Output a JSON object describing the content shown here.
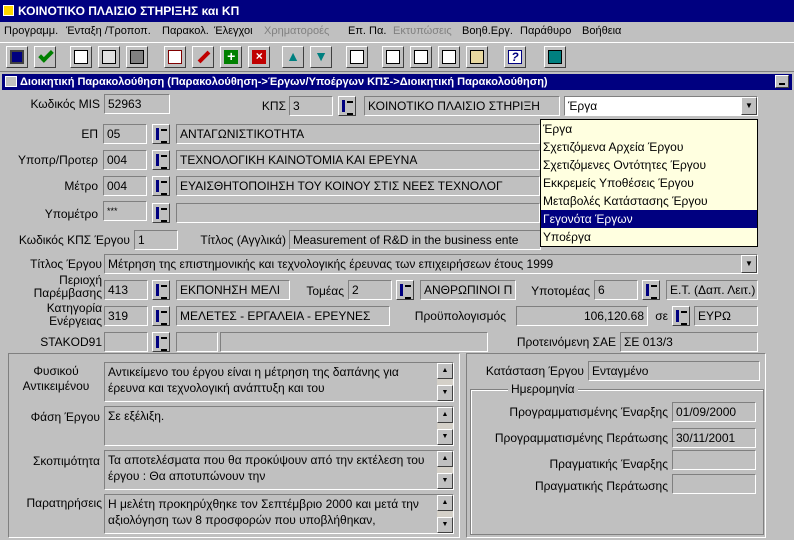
{
  "window": {
    "title": "ΚΟΙΝΟΤΙΚΟ ΠΛΑΙΣΙΟ ΣΤΗΡΙΞΗΣ και ΚΠ"
  },
  "menu": [
    {
      "label": "Προγραμμ.",
      "enabled": true
    },
    {
      "label": "Ένταξη /Τροποπ.",
      "enabled": true
    },
    {
      "label": "Παρακολ.",
      "enabled": true
    },
    {
      "label": "Έλεγχοι",
      "enabled": true
    },
    {
      "label": "Χρηματοροές",
      "enabled": false
    },
    {
      "label": "Επ. Πα.",
      "enabled": true
    },
    {
      "label": "Εκτυπώσεις",
      "enabled": false
    },
    {
      "label": "Βοηθ.Εργ.",
      "enabled": true
    },
    {
      "label": "Παράθυρο",
      "enabled": true
    },
    {
      "label": "Βοήθεια",
      "enabled": true
    }
  ],
  "toolbar_icons": [
    "save-icon",
    "check-icon",
    "print-icon",
    "copy-icon",
    "calculator-icon",
    "chart-icon",
    "edit-icon",
    "add-icon",
    "delete-icon",
    "arrow-up-icon",
    "arrow-down-icon",
    "list-icon",
    "table-icon",
    "document-icon",
    "report-icon",
    "clipboard-icon",
    "help-icon",
    "exit-icon"
  ],
  "subwindow": {
    "title": "Διοικητική Παρακολούθηση (Παρακολούθηση->Έργων/Υποέργων ΚΠΣ->Διοικητική Παρακολούθηση)"
  },
  "form": {
    "mis_label": "Κωδικός MIS",
    "mis_value": "52963",
    "kps_label": "ΚΠΣ",
    "kps_code": "3",
    "kps_name": "ΚΟΙΝΟΤΙΚΟ ΠΛΑΙΣΙΟ ΣΤΗΡΙΞΗ",
    "combo_value": "Έργα",
    "ep_label": "ΕΠ",
    "ep_code": "05",
    "ep_name": "ΑΝΤΑΓΩΝΙΣΤΙΚΟΤΗΤΑ",
    "ypopr_label": "Υποπρ/Προτερ",
    "ypopr_code": "004",
    "ypopr_name": "ΤΕΧΝΟΛΟΓΙΚΗ ΚΑΙΝΟΤΟΜΙΑ ΚΑΙ ΕΡΕΥΝΑ",
    "metro_label": "Μέτρο",
    "metro_code": "004",
    "metro_name": "ΕΥΑΙΣΘΗΤΟΠΟΙΗΣΗ ΤΟΥ ΚΟΙΝΟΥ ΣΤΙΣ ΝΕΕΣ ΤΕΧΝΟΛΟΓ",
    "ypometro_label": "Υπομέτρο",
    "ypometro_code": "***",
    "ypometro_name": "",
    "kps_ergou_label": "Κωδικός ΚΠΣ Έργου",
    "kps_ergou_value": "1",
    "title_en_label": "Τίτλος (Αγγλικά)",
    "title_en_value": "Measurement of R&D in the business ente",
    "title_label": "Τίτλος Έργου",
    "title_value": "Μέτρηση της επιστημονικής και τεχνολογικής έρευνας των επιχειρήσεων έτους 1999",
    "perioxi_label": "Περιοχή Παρέμβασης",
    "perioxi_code": "413",
    "perioxi_name": "ΕΚΠΟΝΗΣΗ ΜΕΛΙ",
    "tomeas_label": "Τομέας",
    "tomeas_code": "2",
    "tomeas_name": "ΑΝΘΡΩΠΙΝΟΙ Π",
    "ypotomeas_label": "Υποτομέας",
    "ypotomeas_code": "6",
    "ypotomeas_name": "Ε.Τ. (Δαπ. Λειτ.)",
    "katigoria_label": "Κατηγορία Ενέργειας",
    "katigoria_code": "319",
    "katigoria_name": "ΜΕΛΕΤΕΣ - ΕΡΓΑΛΕΙΑ - ΕΡΕΥΝΕΣ",
    "budget_label": "Προϋπολογισμός",
    "budget_value": "106,120.68",
    "currency_label": "σε",
    "currency_value": "ΕΥΡΩ",
    "stakod_label": "STAKOD91",
    "sae_label": "Προτεινόμενη ΣΑΕ",
    "sae_value": "ΣΕ 013/3"
  },
  "dropdown_options": [
    {
      "label": "Έργα",
      "selected": false
    },
    {
      "label": "Σχετιζόμενα Αρχεία Έργου",
      "selected": false
    },
    {
      "label": "Σχετιζόμενες Οντότητες Έργου",
      "selected": false
    },
    {
      "label": "Εκκρεμείς Υποθέσεις Έργου",
      "selected": false
    },
    {
      "label": "Μεταβολές Κατάστασης Έργου",
      "selected": false
    },
    {
      "label": "Γεγονότα Έργων",
      "selected": true
    },
    {
      "label": "Υποέργα",
      "selected": false
    }
  ],
  "texts": {
    "fysiko_label": "Φυσικού Αντικειμένου",
    "fysiko_value": "Αντικείμενο του έργου είναι η μέτρηση της δαπάνης για έρευνα και τεχνολογική ανάπτυξη και του",
    "fasi_label": "Φάση Έργου",
    "fasi_value": "Σε εξέλιξη.",
    "skopimotita_label": "Σκοπιμότητα",
    "skopimotita_value": "Τα αποτελέσματα που θα προκύψουν από την εκτέλεση του έργου :    Θα αποτυπώνουν την",
    "paratiriseis_label": "Παρατηρήσεις",
    "paratiriseis_value": "Η μελέτη προκηρύχθηκε τον Σεπτέμβριο 2000 και μετά την αξιολόγηση των 8 προσφορών που υποβλήθηκαν,"
  },
  "status": {
    "label": "Κατάσταση Έργου",
    "value": "Ενταγμένο",
    "dates_group": "Ημερομηνία",
    "planned_start_label": "Προγραμματισμένης Έναρξης",
    "planned_start": "01/09/2000",
    "planned_end_label": "Προγραμματισμένης Περάτωσης",
    "planned_end": "30/11/2001",
    "actual_start_label": "Πραγματικής Έναρξης",
    "actual_start": "",
    "actual_end_label": "Πραγματικής Περάτωσης",
    "actual_end": ""
  }
}
